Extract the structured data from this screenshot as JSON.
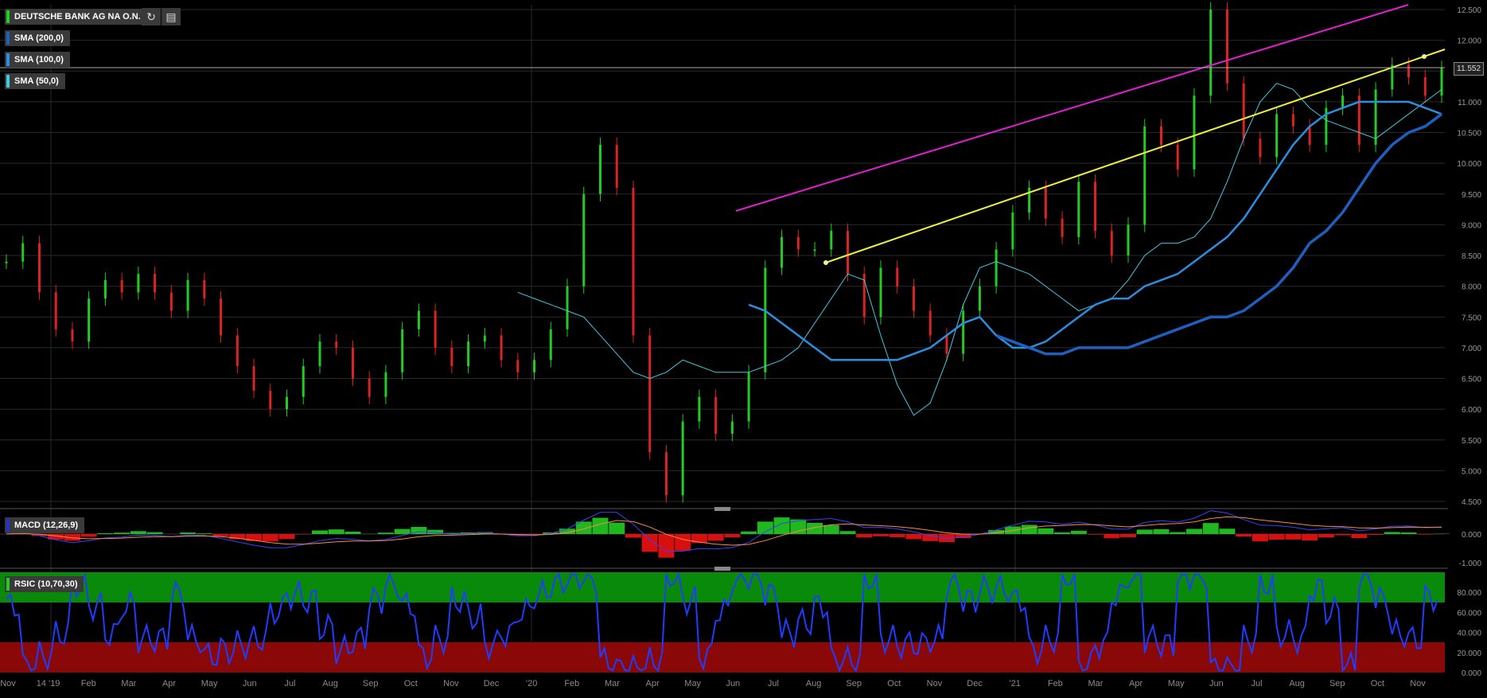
{
  "title_badge": {
    "label": "DEUTSCHE BANK AG NA O.N.",
    "accent": "#22cc22"
  },
  "toolbar": {
    "refresh_glyph": "↻",
    "settings_glyph": "▤"
  },
  "indicators": [
    {
      "label": "SMA (200,0)",
      "color": "#1f5fbf"
    },
    {
      "label": "SMA (100,0)",
      "color": "#2a8fe0"
    },
    {
      "label": "SMA (50,0)",
      "color": "#40c8e0"
    }
  ],
  "last_price": "11.552",
  "macd": {
    "label": "MACD (12,26,9)",
    "color": "#2233cc",
    "ticks": [
      "0.000",
      "-1.000"
    ]
  },
  "rsi": {
    "label": "RSIC (10,70,30)",
    "color": "#22cc22",
    "ticks": [
      "80.000",
      "60.000",
      "40.000",
      "20.000",
      "0.000"
    ]
  },
  "chart_data": {
    "type": "line",
    "y_ticks": [
      "12.500",
      "12.000",
      "11.500",
      "11.000",
      "10.500",
      "10.000",
      "9.500",
      "9.000",
      "8.500",
      "8.000",
      "7.500",
      "7.000",
      "6.500",
      "6.000",
      "5.500",
      "5.000",
      "4.500"
    ],
    "ylim": [
      4.4,
      12.6
    ],
    "x_ticks": [
      "Nov",
      "14 '19",
      "Feb",
      "Mar",
      "Apr",
      "May",
      "Jun",
      "Jul",
      "Aug",
      "Sep",
      "Oct",
      "Nov",
      "Dec",
      "'20",
      "Feb",
      "Mar",
      "Apr",
      "May",
      "Jun",
      "Jul",
      "Aug",
      "Sep",
      "Oct",
      "Nov",
      "Dec",
      "'21",
      "Feb",
      "Mar",
      "Apr",
      "May",
      "Jun",
      "Jul",
      "Aug",
      "Sep",
      "Oct",
      "Nov"
    ],
    "series": [
      {
        "values": [
          8.4,
          8.7,
          7.9,
          7.3,
          7.1,
          7.8,
          8.1,
          7.9,
          8.2,
          7.9,
          7.6,
          8.1,
          7.8,
          7.2,
          6.7,
          6.3,
          6.0,
          6.2,
          6.7,
          7.1,
          7.0,
          6.5,
          6.2,
          6.6,
          7.3,
          7.6,
          7.0,
          6.7,
          7.1,
          7.2,
          6.8,
          6.6,
          6.8,
          7.3,
          8.0,
          9.5,
          10.3,
          9.6,
          7.2,
          5.3,
          4.6,
          5.8,
          6.2,
          5.6,
          5.8,
          6.6,
          8.3,
          8.8,
          8.6,
          8.6,
          8.9,
          8.2,
          7.5,
          8.3,
          8.0,
          7.6,
          7.2,
          6.9,
          7.6,
          8.0,
          8.6,
          9.2,
          9.6,
          9.1,
          8.8,
          9.7,
          8.9,
          8.5,
          9.0,
          10.6,
          10.3,
          9.9,
          11.1,
          12.5,
          11.3,
          10.4,
          10.1,
          10.8,
          10.6,
          10.3,
          10.9,
          11.1,
          10.3,
          11.2,
          11.6,
          11.4,
          11.1,
          11.55
        ]
      },
      {
        "name": "SMA (50,0)",
        "values": [
          null,
          null,
          null,
          null,
          null,
          7.9,
          7.8,
          7.7,
          7.6,
          7.5,
          7.2,
          6.9,
          6.6,
          6.5,
          6.6,
          6.8,
          6.7,
          6.6,
          6.6,
          6.6,
          6.7,
          6.8,
          7.0,
          7.4,
          7.8,
          8.2,
          8.1,
          7.2,
          6.4,
          5.9,
          6.1,
          6.8,
          7.7,
          8.3,
          8.4,
          8.3,
          8.2,
          8.0,
          7.8,
          7.6,
          7.7,
          7.8,
          8.1,
          8.5,
          8.7,
          8.7,
          8.8,
          9.1,
          9.7,
          10.4,
          11.0,
          11.3,
          11.2,
          10.9,
          10.7,
          10.6,
          10.5,
          10.4,
          10.6,
          10.8,
          11.0,
          11.2
        ]
      },
      {
        "name": "SMA (100,0)",
        "values": [
          null,
          null,
          null,
          null,
          null,
          null,
          null,
          7.7,
          7.6,
          7.4,
          7.2,
          7.0,
          6.8,
          6.8,
          6.8,
          6.8,
          6.8,
          6.9,
          7.0,
          7.2,
          7.4,
          7.5,
          7.2,
          7.0,
          7.0,
          7.1,
          7.3,
          7.5,
          7.7,
          7.8,
          7.8,
          8.0,
          8.1,
          8.2,
          8.4,
          8.6,
          8.8,
          9.1,
          9.5,
          9.9,
          10.3,
          10.6,
          10.8,
          10.9,
          11.0,
          11.0,
          11.0,
          11.0,
          10.9,
          10.8
        ]
      },
      {
        "name": "SMA (200,0)",
        "values": [
          null,
          null,
          null,
          null,
          null,
          null,
          null,
          null,
          null,
          null,
          7.2,
          7.1,
          7.0,
          6.9,
          6.9,
          7.0,
          7.0,
          7.0,
          7.0,
          7.1,
          7.2,
          7.3,
          7.4,
          7.5,
          7.5,
          7.6,
          7.8,
          8.0,
          8.3,
          8.7,
          8.9,
          9.2,
          9.6,
          10.0,
          10.3,
          10.5,
          10.6,
          10.8
        ]
      }
    ]
  }
}
